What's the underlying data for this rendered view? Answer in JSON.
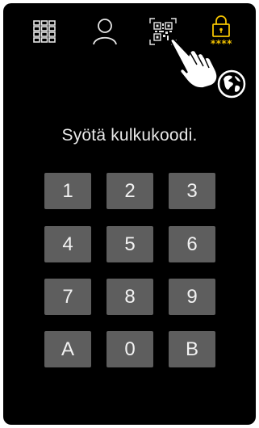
{
  "tabs": [
    {
      "name": "keypad-grid-icon"
    },
    {
      "name": "user-icon"
    },
    {
      "name": "qr-code-icon"
    },
    {
      "name": "lock-code-icon"
    }
  ],
  "lock_code_label": "****",
  "prompt": "Syötä kulkukoodi.",
  "keys": [
    "1",
    "2",
    "3",
    "4",
    "5",
    "6",
    "7",
    "8",
    "9",
    "A",
    "0",
    "B"
  ],
  "colors": {
    "background": "#000000",
    "key": "#5e5e5e",
    "accent": "#f5c400",
    "text": "#e8e8e8"
  }
}
